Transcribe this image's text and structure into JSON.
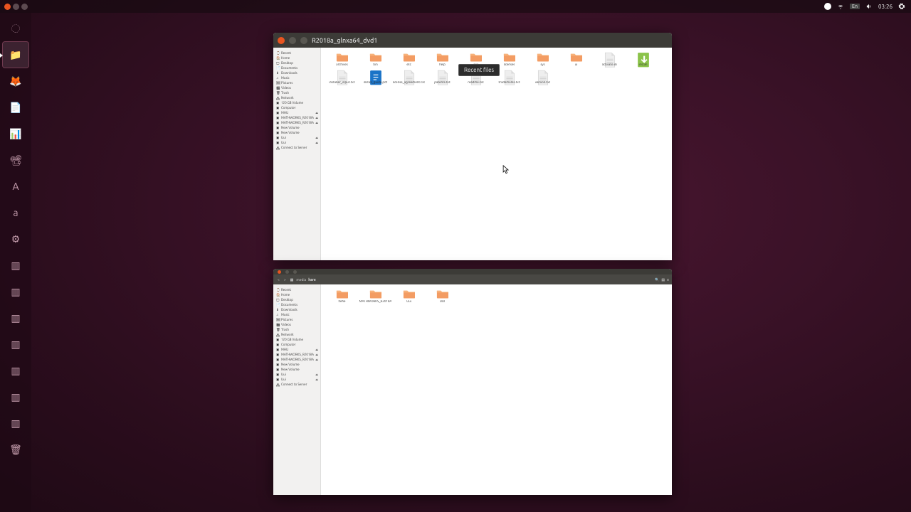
{
  "menubar": {
    "lang": "En",
    "time": "03:26"
  },
  "launcher_items": [
    {
      "name": "dash",
      "glyph": "◌"
    },
    {
      "name": "files",
      "glyph": "📁",
      "active": true,
      "running": true
    },
    {
      "name": "firefox",
      "glyph": "🦊"
    },
    {
      "name": "writer",
      "glyph": "📄"
    },
    {
      "name": "calc",
      "glyph": "📊"
    },
    {
      "name": "impress",
      "glyph": "📽"
    },
    {
      "name": "software",
      "glyph": "A"
    },
    {
      "name": "amazon",
      "glyph": "a"
    },
    {
      "name": "settings",
      "glyph": "⚙"
    },
    {
      "name": "drive1",
      "glyph": "▥"
    },
    {
      "name": "drive2",
      "glyph": "▥"
    },
    {
      "name": "drive3",
      "glyph": "▥"
    },
    {
      "name": "drive4",
      "glyph": "▥"
    },
    {
      "name": "drive5",
      "glyph": "▥"
    },
    {
      "name": "drive6",
      "glyph": "▥"
    },
    {
      "name": "drive7",
      "glyph": "▥"
    },
    {
      "name": "trash",
      "glyph": "🗑"
    }
  ],
  "sidebar_items": [
    {
      "icon": "⌚",
      "label": "Recent"
    },
    {
      "icon": "🏠",
      "label": "Home"
    },
    {
      "icon": "🖵",
      "label": "Desktop"
    },
    {
      "icon": "📄",
      "label": "Documents"
    },
    {
      "icon": "⬇",
      "label": "Downloads"
    },
    {
      "icon": "♫",
      "label": "Music"
    },
    {
      "icon": "🖼",
      "label": "Pictures"
    },
    {
      "icon": "🎬",
      "label": "Videos"
    },
    {
      "icon": "🗑",
      "label": "Trash"
    },
    {
      "icon": "🖧",
      "label": "Network"
    },
    {
      "icon": "▣",
      "label": "120 GB Volume"
    },
    {
      "icon": "▣",
      "label": "Computer"
    },
    {
      "icon": "▣",
      "label": "MHU",
      "ej": true
    },
    {
      "icon": "▣",
      "label": "MATHWORKS_R2018A",
      "ej": true
    },
    {
      "icon": "▣",
      "label": "MATHWORKS_R2018A",
      "ej": true
    },
    {
      "icon": "▣",
      "label": "New Volume"
    },
    {
      "icon": "▣",
      "label": "New Volume"
    },
    {
      "icon": "▣",
      "label": "Uui",
      "ej": true
    },
    {
      "icon": "▣",
      "label": "Uui",
      "ej": true
    },
    {
      "icon": "🖧",
      "label": "Connect to Server"
    }
  ],
  "window1": {
    "title": "R2018a_glnxa64_dvd1",
    "items": [
      {
        "type": "folder",
        "label": "archives"
      },
      {
        "type": "folder",
        "label": "bin"
      },
      {
        "type": "folder",
        "label": "etc"
      },
      {
        "type": "folder",
        "label": "help"
      },
      {
        "type": "folder",
        "label": "java"
      },
      {
        "type": "folder",
        "label": "licenses"
      },
      {
        "type": "folder",
        "label": "sys"
      },
      {
        "type": "folder",
        "label": "ui"
      },
      {
        "type": "file",
        "label": "activate.ini"
      },
      {
        "type": "install",
        "label": "install"
      },
      {
        "type": "file",
        "label": "installer_input.txt"
      },
      {
        "type": "pdf",
        "label": "install_guide.pdf"
      },
      {
        "type": "file",
        "label": "license_agreement.txt"
      },
      {
        "type": "file",
        "label": "patents.txt"
      },
      {
        "type": "file",
        "label": "readme.txt"
      },
      {
        "type": "file",
        "label": "trademarks.txt"
      },
      {
        "type": "file",
        "label": "version.txt"
      }
    ]
  },
  "window2": {
    "breadcrumb": [
      "media",
      "hare"
    ],
    "items": [
      {
        "type": "folder",
        "label": "hehe"
      },
      {
        "type": "folder",
        "label": "MATHWORKS_R2018A"
      },
      {
        "type": "folder",
        "label": "Uui"
      },
      {
        "type": "folder",
        "label": "UUI"
      }
    ]
  },
  "tooltip": "Recent files"
}
